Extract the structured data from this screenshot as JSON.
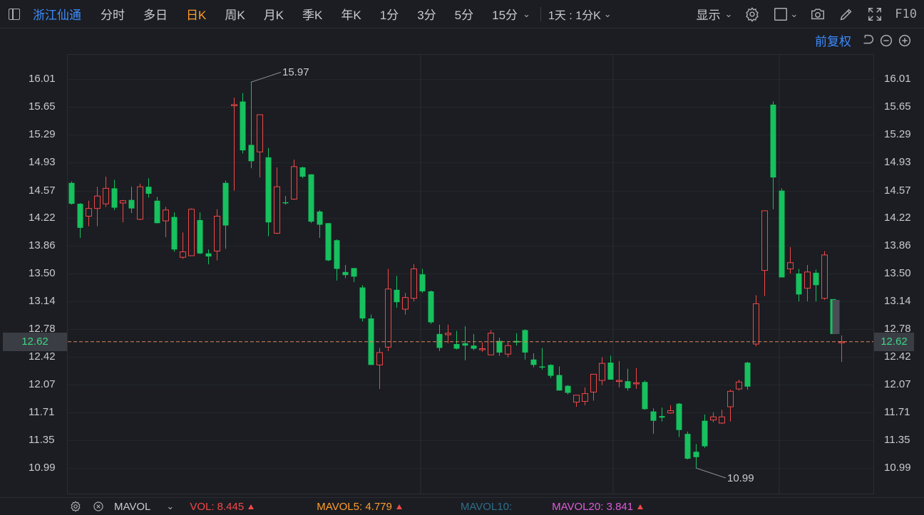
{
  "toolbar": {
    "stock_name": "浙江仙通",
    "tabs": [
      {
        "label": "分时",
        "active": false
      },
      {
        "label": "多日",
        "active": false
      },
      {
        "label": "日K",
        "active": true
      },
      {
        "label": "周K",
        "active": false
      },
      {
        "label": "月K",
        "active": false
      },
      {
        "label": "季K",
        "active": false
      },
      {
        "label": "年K",
        "active": false
      },
      {
        "label": "1分",
        "active": false
      },
      {
        "label": "3分",
        "active": false
      },
      {
        "label": "5分",
        "active": false
      },
      {
        "label": "15分",
        "active": false
      }
    ],
    "range_label": "1天 : 1分K",
    "display_label": "显示",
    "f10_label": "F10",
    "icons": [
      "sidebar-toggle-icon",
      "chevron-down-icon",
      "gear-icon",
      "square-icon",
      "camera-icon",
      "pencil-icon",
      "fullscreen-icon"
    ]
  },
  "subbar": {
    "adjust_label": "前复权"
  },
  "price_axis": {
    "ticks": [
      "16.01",
      "15.65",
      "15.29",
      "14.93",
      "14.57",
      "14.22",
      "13.86",
      "13.50",
      "13.14",
      "12.78",
      "12.42",
      "12.07",
      "11.71",
      "11.35",
      "10.99"
    ],
    "current_price": "12.62"
  },
  "annotations": {
    "high_label": "15.97",
    "low_label": "10.99"
  },
  "colors": {
    "up": "#f04848",
    "down": "#16c15e",
    "background": "#1b1d22",
    "grid": "#2a2d33",
    "accent": "#ff9d2e",
    "link": "#3d8bfd",
    "price_line": "#e0855a"
  },
  "chart_data": {
    "type": "candlestick",
    "y_range": [
      10.8,
      16.25
    ],
    "candles": [
      {
        "o": 14.67,
        "h": 14.69,
        "l": 14.39,
        "c": 14.4
      },
      {
        "o": 14.4,
        "h": 14.41,
        "l": 13.96,
        "c": 14.09
      },
      {
        "o": 14.24,
        "h": 14.44,
        "l": 14.11,
        "c": 14.34
      },
      {
        "o": 14.34,
        "h": 14.62,
        "l": 14.11,
        "c": 14.5
      },
      {
        "o": 14.4,
        "h": 14.75,
        "l": 14.36,
        "c": 14.6
      },
      {
        "o": 14.6,
        "h": 14.71,
        "l": 14.32,
        "c": 14.35
      },
      {
        "o": 14.41,
        "h": 14.45,
        "l": 14.16,
        "c": 14.44
      },
      {
        "o": 14.45,
        "h": 14.62,
        "l": 14.28,
        "c": 14.34
      },
      {
        "o": 14.2,
        "h": 14.66,
        "l": 14.19,
        "c": 14.62
      },
      {
        "o": 14.62,
        "h": 14.73,
        "l": 14.48,
        "c": 14.53
      },
      {
        "o": 14.44,
        "h": 14.49,
        "l": 14.15,
        "c": 14.15
      },
      {
        "o": 14.18,
        "h": 14.36,
        "l": 13.97,
        "c": 14.32
      },
      {
        "o": 14.23,
        "h": 14.29,
        "l": 13.78,
        "c": 13.81
      },
      {
        "o": 13.71,
        "h": 14.03,
        "l": 13.69,
        "c": 13.78
      },
      {
        "o": 13.73,
        "h": 14.34,
        "l": 13.73,
        "c": 14.33
      },
      {
        "o": 14.19,
        "h": 14.29,
        "l": 13.75,
        "c": 13.76
      },
      {
        "o": 13.76,
        "h": 13.81,
        "l": 13.62,
        "c": 13.72
      },
      {
        "o": 13.79,
        "h": 14.33,
        "l": 13.67,
        "c": 14.24
      },
      {
        "o": 14.67,
        "h": 14.7,
        "l": 13.82,
        "c": 14.12
      },
      {
        "o": 15.68,
        "h": 15.77,
        "l": 14.57,
        "c": 15.68
      },
      {
        "o": 15.72,
        "h": 15.83,
        "l": 15.05,
        "c": 15.09
      },
      {
        "o": 15.16,
        "h": 15.97,
        "l": 14.86,
        "c": 14.95
      },
      {
        "o": 15.07,
        "h": 15.46,
        "l": 14.74,
        "c": 15.55
      },
      {
        "o": 15.0,
        "h": 15.12,
        "l": 13.98,
        "c": 14.16
      },
      {
        "o": 14.02,
        "h": 14.87,
        "l": 14.01,
        "c": 14.62
      },
      {
        "o": 14.42,
        "h": 14.5,
        "l": 14.39,
        "c": 14.41
      },
      {
        "o": 14.46,
        "h": 14.97,
        "l": 14.45,
        "c": 14.88
      },
      {
        "o": 14.87,
        "h": 14.88,
        "l": 14.73,
        "c": 14.75
      },
      {
        "o": 14.78,
        "h": 14.78,
        "l": 14.15,
        "c": 14.17
      },
      {
        "o": 14.3,
        "h": 14.32,
        "l": 13.96,
        "c": 14.13
      },
      {
        "o": 14.15,
        "h": 14.15,
        "l": 13.66,
        "c": 13.67
      },
      {
        "o": 13.93,
        "h": 13.94,
        "l": 13.41,
        "c": 13.56
      },
      {
        "o": 13.52,
        "h": 13.61,
        "l": 13.44,
        "c": 13.48
      },
      {
        "o": 13.57,
        "h": 13.57,
        "l": 13.39,
        "c": 13.46
      },
      {
        "o": 13.32,
        "h": 13.35,
        "l": 12.88,
        "c": 12.92
      },
      {
        "o": 12.92,
        "h": 12.97,
        "l": 12.34,
        "c": 12.32
      },
      {
        "o": 12.32,
        "h": 12.54,
        "l": 12.01,
        "c": 12.48
      },
      {
        "o": 12.55,
        "h": 13.56,
        "l": 12.5,
        "c": 13.3
      },
      {
        "o": 13.29,
        "h": 13.47,
        "l": 13.06,
        "c": 13.13
      },
      {
        "o": 13.04,
        "h": 13.25,
        "l": 12.97,
        "c": 13.19
      },
      {
        "o": 13.18,
        "h": 13.62,
        "l": 13.14,
        "c": 13.56
      },
      {
        "o": 13.49,
        "h": 13.56,
        "l": 13.25,
        "c": 13.27
      },
      {
        "o": 13.27,
        "h": 13.28,
        "l": 12.85,
        "c": 12.87
      },
      {
        "o": 12.72,
        "h": 12.84,
        "l": 12.5,
        "c": 12.54
      },
      {
        "o": 12.71,
        "h": 12.84,
        "l": 12.6,
        "c": 12.73
      },
      {
        "o": 12.59,
        "h": 12.76,
        "l": 12.52,
        "c": 12.53
      },
      {
        "o": 12.6,
        "h": 12.82,
        "l": 12.38,
        "c": 12.57
      },
      {
        "o": 12.57,
        "h": 12.72,
        "l": 12.51,
        "c": 12.53
      },
      {
        "o": 12.52,
        "h": 12.61,
        "l": 12.49,
        "c": 12.53
      },
      {
        "o": 12.45,
        "h": 12.77,
        "l": 12.46,
        "c": 12.73
      },
      {
        "o": 12.63,
        "h": 12.67,
        "l": 12.44,
        "c": 12.48
      },
      {
        "o": 12.46,
        "h": 12.61,
        "l": 12.42,
        "c": 12.57
      },
      {
        "o": 12.63,
        "h": 12.73,
        "l": 12.57,
        "c": 12.61
      },
      {
        "o": 12.77,
        "h": 12.78,
        "l": 12.39,
        "c": 12.48
      },
      {
        "o": 12.39,
        "h": 12.47,
        "l": 12.29,
        "c": 12.32
      },
      {
        "o": 12.3,
        "h": 12.54,
        "l": 12.26,
        "c": 12.29
      },
      {
        "o": 12.32,
        "h": 12.33,
        "l": 12.15,
        "c": 12.18
      },
      {
        "o": 12.19,
        "h": 12.3,
        "l": 11.99,
        "c": 11.99
      },
      {
        "o": 12.05,
        "h": 12.06,
        "l": 11.94,
        "c": 11.96
      },
      {
        "o": 11.84,
        "h": 11.93,
        "l": 11.78,
        "c": 11.93
      },
      {
        "o": 11.85,
        "h": 12.03,
        "l": 11.8,
        "c": 11.95
      },
      {
        "o": 11.97,
        "h": 12.2,
        "l": 11.86,
        "c": 12.2
      },
      {
        "o": 12.12,
        "h": 12.42,
        "l": 12.06,
        "c": 12.34
      },
      {
        "o": 12.35,
        "h": 12.44,
        "l": 12.13,
        "c": 12.13
      },
      {
        "o": 12.12,
        "h": 12.37,
        "l": 12.03,
        "c": 12.12
      },
      {
        "o": 12.11,
        "h": 12.27,
        "l": 11.99,
        "c": 12.02
      },
      {
        "o": 12.09,
        "h": 12.28,
        "l": 12.01,
        "c": 12.09
      },
      {
        "o": 12.1,
        "h": 12.12,
        "l": 11.74,
        "c": 11.75
      },
      {
        "o": 11.72,
        "h": 11.76,
        "l": 11.43,
        "c": 11.6
      },
      {
        "o": 11.66,
        "h": 11.77,
        "l": 11.59,
        "c": 11.64
      },
      {
        "o": 11.7,
        "h": 11.8,
        "l": 11.69,
        "c": 11.73
      },
      {
        "o": 11.82,
        "h": 11.83,
        "l": 11.39,
        "c": 11.48
      },
      {
        "o": 11.43,
        "h": 11.46,
        "l": 11.1,
        "c": 11.11
      },
      {
        "o": 11.2,
        "h": 11.3,
        "l": 10.99,
        "c": 11.13
      },
      {
        "o": 11.6,
        "h": 11.68,
        "l": 11.25,
        "c": 11.27
      },
      {
        "o": 11.61,
        "h": 11.71,
        "l": 11.58,
        "c": 11.65
      },
      {
        "o": 11.57,
        "h": 11.74,
        "l": 11.56,
        "c": 11.65
      },
      {
        "o": 11.78,
        "h": 12.0,
        "l": 11.59,
        "c": 11.98
      },
      {
        "o": 12.01,
        "h": 12.13,
        "l": 11.99,
        "c": 12.1
      },
      {
        "o": 12.35,
        "h": 12.36,
        "l": 12.0,
        "c": 12.04
      },
      {
        "o": 12.59,
        "h": 13.22,
        "l": 12.56,
        "c": 13.11
      },
      {
        "o": 13.54,
        "h": 14.31,
        "l": 13.21,
        "c": 14.31
      },
      {
        "o": 15.68,
        "h": 15.72,
        "l": 14.33,
        "c": 14.74
      },
      {
        "o": 14.57,
        "h": 14.6,
        "l": 13.47,
        "c": 13.45
      },
      {
        "o": 13.56,
        "h": 13.84,
        "l": 13.5,
        "c": 13.64
      },
      {
        "o": 13.5,
        "h": 13.56,
        "l": 13.14,
        "c": 13.23
      },
      {
        "o": 13.31,
        "h": 13.61,
        "l": 13.14,
        "c": 13.52
      },
      {
        "o": 13.51,
        "h": 13.55,
        "l": 13.14,
        "c": 13.35
      },
      {
        "o": 13.18,
        "h": 13.79,
        "l": 13.16,
        "c": 13.74
      },
      {
        "o": 13.17,
        "h": 13.16,
        "l": 12.72,
        "c": 12.72
      },
      {
        "o": 12.62,
        "h": 12.7,
        "l": 12.36,
        "c": 12.62
      }
    ],
    "price_ticks": [
      16.01,
      15.65,
      15.29,
      14.93,
      14.57,
      14.22,
      13.86,
      13.5,
      13.14,
      12.78,
      12.42,
      12.07,
      11.71,
      11.35,
      10.99
    ],
    "current_price": 12.62,
    "high": 15.97,
    "low": 10.99
  },
  "indicators": {
    "name": "MAVOL",
    "vol_label": "VOL:",
    "vol_value": "8.445",
    "mavol5_label": "MAVOL5:",
    "mavol5_value": "4.779",
    "mavol10_label": "MAVOL10:",
    "mavol10_value": "",
    "mavol20_label": "MAVOL20:",
    "mavol20_value": "3.841"
  }
}
